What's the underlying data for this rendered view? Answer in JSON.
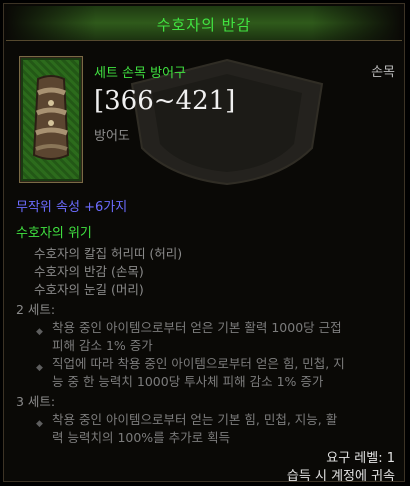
{
  "header": {
    "title": "수호자의 반감"
  },
  "item": {
    "icon": "bracer-icon",
    "type": "세트 손목 방어구",
    "slot": "손목",
    "armor_value": "[366~421]",
    "armor_label": "방어도",
    "random_props": "무작위 속성 +6가지"
  },
  "set": {
    "name": "수호자의 위기",
    "pieces": [
      "수호자의 칼집 허리띠 (허리)",
      "수호자의 반감 (손목)",
      "수호자의 눈길 (머리)"
    ],
    "bonus2": {
      "head": "2 세트:",
      "lines": [
        [
          "착용 중인 아이템으로부터 얻은 기본 활력 1000당 근접",
          "피해 감소 1% 증가"
        ],
        [
          "직업에 따라 착용 중인 아이템으로부터 얻은 힘, 민첩, 지",
          "능 중 한 능력치 1000당 투사체 피해 감소 1% 증가"
        ]
      ]
    },
    "bonus3": {
      "head": "3 세트:",
      "lines": [
        [
          "착용 중인 아이템으로부터 얻는 기본 힘, 민첩, 지능, 활",
          "력 능력치의 100%를 추가로 획득"
        ]
      ]
    }
  },
  "footer": {
    "required_level": "요구 레벨: 1",
    "account_bound": "습득 시 계정에 귀속"
  },
  "colors": {
    "set_green": "#41e341",
    "magic_blue": "#6c6cff",
    "muted_gray": "#8a8a8a"
  }
}
